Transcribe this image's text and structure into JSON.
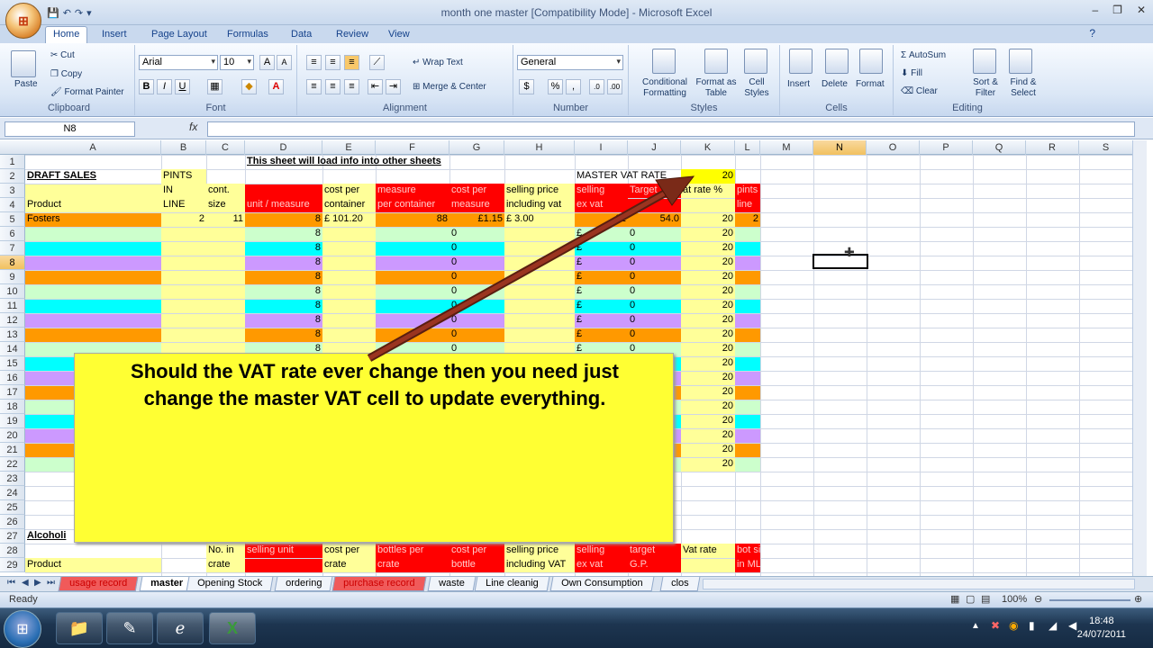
{
  "window": {
    "title": "month one master  [Compatibility Mode] - Microsoft Excel",
    "minimize": "–",
    "restore": "❐",
    "close": "✕"
  },
  "office_button": {
    "label": "⊞"
  },
  "ribbon_tabs": [
    "Home",
    "Insert",
    "Page Layout",
    "Formulas",
    "Data",
    "Review",
    "View"
  ],
  "ribbon": {
    "clipboard": {
      "label": "Clipboard",
      "paste": "Paste",
      "cut": "Cut",
      "copy": "Copy",
      "format_painter": "Format Painter"
    },
    "font": {
      "label": "Font",
      "font_name": "Arial",
      "font_size": "10",
      "bold": "B",
      "italic": "I",
      "underline": "U"
    },
    "alignment": {
      "label": "Alignment",
      "wrap_text": "Wrap Text",
      "merge_center": "Merge & Center"
    },
    "number": {
      "label": "Number",
      "format": "General",
      "percent": "%",
      "comma": ","
    },
    "styles": {
      "label": "Styles",
      "conditional_formatting": "Conditional Formatting",
      "format_as_table": "Format as Table",
      "cell_styles": "Cell Styles"
    },
    "cells": {
      "label": "Cells",
      "insert": "Insert",
      "delete": "Delete",
      "format": "Format"
    },
    "editing": {
      "label": "Editing",
      "autosum": "AutoSum",
      "fill": "Fill",
      "clear": "Clear",
      "sort_filter": "Sort & Filter",
      "find_select": "Find & Select"
    }
  },
  "formula_bar": {
    "name_box": "N8",
    "fx": "fx",
    "value": ""
  },
  "columns": [
    "A",
    "B",
    "C",
    "D",
    "E",
    "F",
    "G",
    "H",
    "I",
    "J",
    "K",
    "L",
    "M",
    "N",
    "O",
    "P",
    "Q",
    "R",
    "S"
  ],
  "rows": [
    "1",
    "2",
    "3",
    "4",
    "5",
    "6",
    "7",
    "8",
    "9",
    "10",
    "11",
    "12",
    "13",
    "14",
    "15",
    "16",
    "17",
    "18",
    "19",
    "20",
    "21",
    "22",
    "23",
    "24",
    "25",
    "26",
    "27",
    "28",
    "29"
  ],
  "cells": {
    "title": "This sheet will load info into other sheets",
    "draft_sales": "DRAFT SALES",
    "master_vat_label": "MASTER VAT RATE",
    "master_vat_value": "20",
    "hdr_pints_1": "PINTS",
    "hdr_pints_2": "IN",
    "hdr_pints_3": "LINE",
    "hdr_cont_1": "cont.",
    "hdr_cont_2": "size",
    "hdr_product": "Product",
    "hdr_unit_measure": "unit / measure",
    "hdr_cost_container_1": "cost per",
    "hdr_cost_container_2": "container",
    "hdr_measure_container_1": "measure",
    "hdr_measure_container_2": "per container",
    "hdr_cost_measure_1": "cost per",
    "hdr_cost_measure_2": "measure",
    "hdr_selling_inc_1": "selling price",
    "hdr_selling_inc_2": "including vat",
    "hdr_selling_ex_1": "selling",
    "hdr_selling_ex_2": "ex vat",
    "hdr_target_1": "Target",
    "hdr_vat_rate": "at rate %",
    "hdr_pints_line_1": "pints in",
    "hdr_pints_line_2": "line",
    "r5_product": "Fosters",
    "r5_pints": "2",
    "r5_cont": "11",
    "r5_unit": "8",
    "r5_cost_container": "£  101.20",
    "r5_measure": "88",
    "r5_cost_measure": "£1.15",
    "r5_selling_inc": "£       3.00",
    "r5_selling_ex": "£2",
    "r5_target": "54.0",
    "r5_vat": "20",
    "r5_pints_line": "2",
    "unit_default": "8",
    "zero": "0",
    "pound": "£",
    "dash": "-",
    "vat_default": "20",
    "alcoholic": "Alcoholi",
    "hdr28_crate_1": "No. in",
    "hdr28_crate_2": "crate",
    "hdr28_selling_unit": "selling unit",
    "hdr28_cost_crate_1": "cost per",
    "hdr28_cost_crate_2": "crate",
    "hdr28_bottles_1": "bottles per",
    "hdr28_bottles_2": "crate",
    "hdr28_cost_bottle_1": "cost per",
    "hdr28_cost_bottle_2": "bottle",
    "hdr28_selling_1": "selling price",
    "hdr28_selling_2": "including VAT",
    "hdr28_ex_1": "selling",
    "hdr28_ex_2": "ex vat",
    "hdr28_target_1": "target",
    "hdr28_target_2": "G.P.",
    "hdr28_vat": "Vat rate",
    "hdr28_bot_1": "bot size",
    "hdr28_bot_2": "in ML",
    "r29_product": "Product"
  },
  "popup": {
    "line1": "Should the VAT rate ever change then you need just",
    "line2": "change the master VAT cell to update everything."
  },
  "sheet_tabs": [
    {
      "label": "usage record",
      "style": "red"
    },
    {
      "label": "master",
      "style": "active"
    },
    {
      "label": "Opening Stock",
      "style": "normal"
    },
    {
      "label": "ordering",
      "style": "normal"
    },
    {
      "label": "purchase record",
      "style": "red"
    },
    {
      "label": "waste",
      "style": "normal"
    },
    {
      "label": "Line cleanig",
      "style": "normal"
    },
    {
      "label": "Own Consumption",
      "style": "normal"
    },
    {
      "label": "clos",
      "style": "normal"
    }
  ],
  "status": {
    "ready": "Ready",
    "zoom": "100%"
  },
  "taskbar": {
    "time": "18:48",
    "date": "24/07/2011"
  },
  "colors": {
    "orange": "#ff9900",
    "green": "#ccffcc",
    "cyan": "#00ffff",
    "purple": "#cc99ff",
    "red": "#ff0000",
    "yellow": "#ffff99",
    "bright_yellow": "#ffff00",
    "popup": "#ffff33"
  }
}
